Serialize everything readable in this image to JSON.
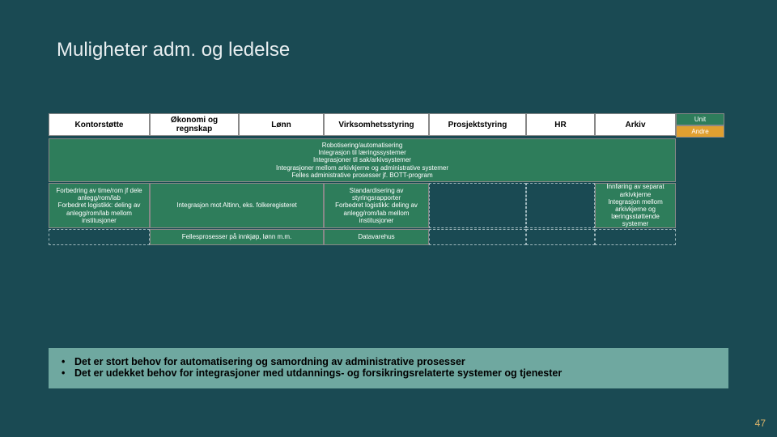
{
  "title": "Muligheter adm. og ledelse",
  "headers": {
    "c1": "Kontorstøtte",
    "c2": "Økonomi og regnskap",
    "c3": "Lønn",
    "c4": "Virksomhetsstyring",
    "c5": "Prosjektstyring",
    "c6": "HR",
    "c7": "Arkiv"
  },
  "legend": {
    "unit": "Unit",
    "andre": "Andre"
  },
  "row_full": "Robotisering/automatisering\nIntegrasjon til læringssystemer\nIntegrasjoner til sak/arkivsystemer\nIntegrasjoner mellom arkivkjerne og administrative systemer\nFelles administrative prosesser jf. BOTT-program",
  "row2": {
    "a": "Forbedring av time/rom jf dele anlegg/rom/lab\nForbedret logistikk: deling av anlegg/rom/lab mellom institusjoner",
    "b": "Integrasjon mot Altinn, eks. folkeregisteret",
    "c": "Standardisering av styringsrapporter\nForbedret logistikk: deling av anlegg/rom/lab mellom institusjoner",
    "f": "Innføring av separat arkivkjerne\nIntegrasjon mellom arkivkjerne og læringsstøttende systemer"
  },
  "row3": {
    "b": "Fellesprosesser på innkjøp, lønn m.m.",
    "c": "Datavarehus"
  },
  "bullets": [
    "Det er stort behov for automatisering og samordning av administrative prosesser",
    "Det er udekket behov for integrasjoner med utdannings- og forsikringsrelaterte systemer og tjenester"
  ],
  "page": "47"
}
